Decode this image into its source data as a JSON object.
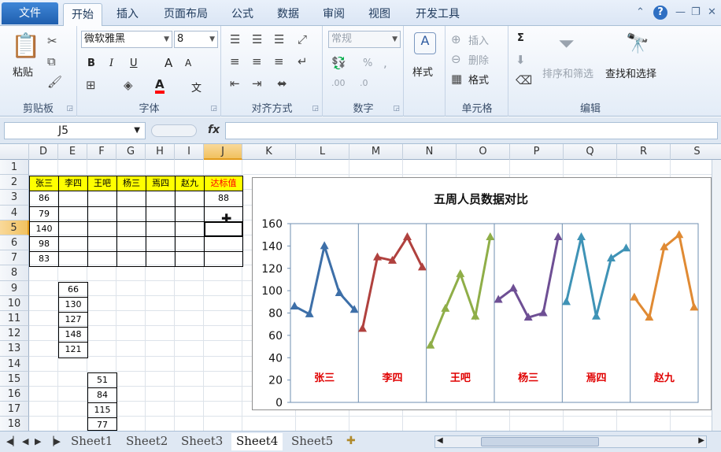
{
  "tabs": {
    "file": "文件",
    "items": [
      "开始",
      "插入",
      "页面布局",
      "公式",
      "数据",
      "审阅",
      "视图",
      "开发工具"
    ],
    "active_index": 0
  },
  "ribbon": {
    "clipboard": {
      "paste": "粘贴",
      "label": "剪贴板"
    },
    "font": {
      "name": "微软雅黑",
      "size": "8",
      "bold": "B",
      "italic": "I",
      "underline": "U",
      "grow": "A",
      "color_letter": "A",
      "phonetic": "文",
      "label": "字体",
      "font_color": "#ff0000"
    },
    "align": {
      "label": "对齐方式"
    },
    "number": {
      "format": "常规",
      "percent": "%",
      "label": "数字"
    },
    "styles": {
      "label": "样式"
    },
    "cells": {
      "insert": "插入",
      "delete": "删除",
      "format": "格式",
      "label": "单元格"
    },
    "editing": {
      "sort": "排序和筛选",
      "find": "查找和选择",
      "sum": "Σ",
      "label": "编辑"
    }
  },
  "formula_bar": {
    "name_box": "J5",
    "fx": "fx",
    "value": ""
  },
  "columns": [
    "D",
    "E",
    "F",
    "G",
    "H",
    "I",
    "J",
    "K",
    "L",
    "M",
    "N",
    "O",
    "P",
    "Q",
    "R",
    "S"
  ],
  "selected_column": "J",
  "rows": [
    "1",
    "2",
    "3",
    "4",
    "5",
    "6",
    "7",
    "8",
    "9",
    "10",
    "11",
    "12",
    "13",
    "14",
    "15",
    "16",
    "17",
    "18"
  ],
  "selected_row": "5",
  "table": {
    "headers": [
      "张三",
      "李四",
      "王吧",
      "杨三",
      "焉四",
      "赵九",
      "达标值"
    ],
    "col_d_values": [
      "86",
      "79",
      "140",
      "98",
      "83"
    ],
    "target_value": "88"
  },
  "list_e": [
    "66",
    "130",
    "127",
    "148",
    "121"
  ],
  "list_f": [
    "51",
    "84",
    "115",
    "77"
  ],
  "chart_data": {
    "type": "line",
    "title": "五周人员数据对比",
    "ylim": [
      0,
      160
    ],
    "yticks": [
      "0",
      "20",
      "40",
      "60",
      "80",
      "100",
      "120",
      "140",
      "160"
    ],
    "grid": false,
    "series": [
      {
        "name": "张三",
        "values": [
          86,
          79,
          140,
          98,
          83
        ],
        "color": "#3d6fa8"
      },
      {
        "name": "李四",
        "values": [
          66,
          130,
          127,
          148,
          121
        ],
        "color": "#b0413e"
      },
      {
        "name": "王吧",
        "values": [
          51,
          84,
          115,
          77,
          148
        ],
        "color": "#8fae48"
      },
      {
        "name": "杨三",
        "values": [
          92,
          102,
          76,
          80,
          148
        ],
        "color": "#6e4f94"
      },
      {
        "name": "焉四",
        "values": [
          90,
          148,
          77,
          129,
          138
        ],
        "color": "#3f93b6"
      },
      {
        "name": "赵九",
        "values": [
          94,
          76,
          139,
          150,
          85
        ],
        "color": "#e08a33"
      }
    ],
    "label_color": "#e00000"
  },
  "sheet_tabs": [
    "Sheet1",
    "Sheet2",
    "Sheet3",
    "Sheet4",
    "Sheet5"
  ],
  "active_sheet": "Sheet4"
}
